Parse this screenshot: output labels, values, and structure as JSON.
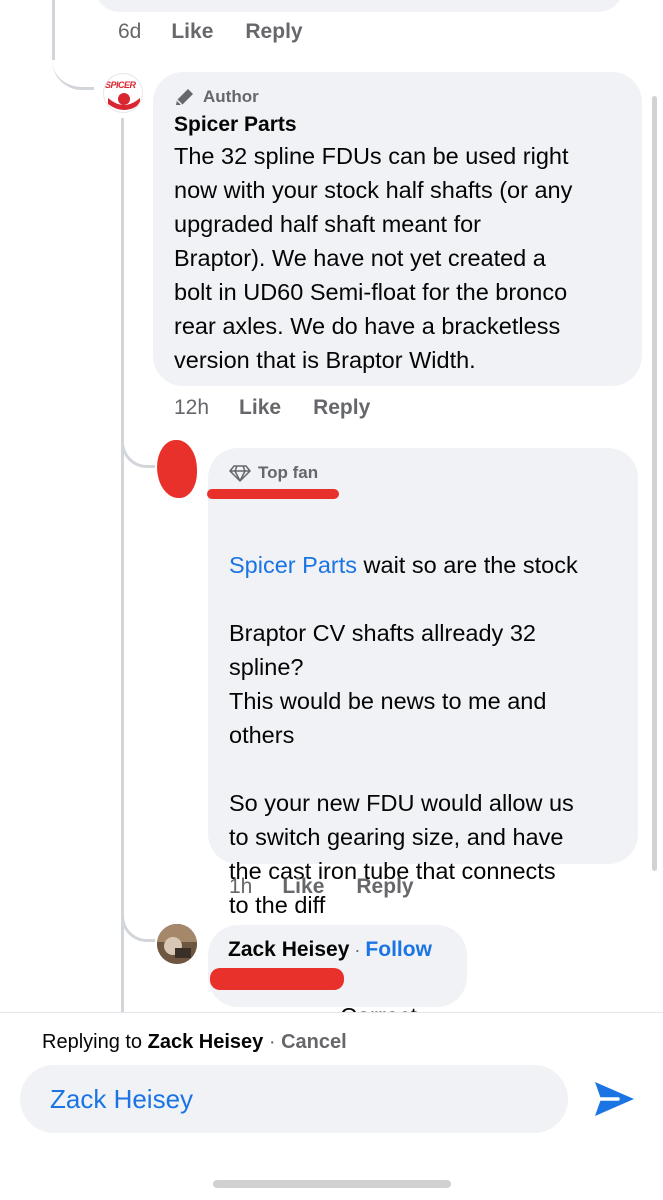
{
  "previous_comment": {
    "time": "6d",
    "like_label": "Like",
    "reply_label": "Reply"
  },
  "author_comment": {
    "avatar_text": "SPICER",
    "badge": "Author",
    "badge_icon": "pencil-icon",
    "name": "Spicer Parts",
    "text": "The 32 spline FDUs can be used right\nnow with your stock half shafts (or any\nupgraded half shaft meant for\nBraptor).  We have not yet created a\nbolt in UD60 Semi-float for the bronco\nrear axles.  We do have a bracketless\nversion that is Braptor Width.",
    "time": "12h",
    "like_label": "Like",
    "reply_label": "Reply"
  },
  "fan_comment": {
    "badge": "Top fan",
    "badge_icon": "diamond-icon",
    "mention": "Spicer Parts",
    "text_first_line": " wait so are the stock",
    "text_rest": "Braptor CV shafts allready 32\nspline?\nThis would be news to me and\nothers\n\nSo your new FDU would allow us\nto switch gearing size, and have\nthe cast iron tube that connects\nto the diff",
    "time": "1h",
    "like_label": "Like",
    "reply_label": "Reply"
  },
  "zack_comment": {
    "name": "Zack Heisey",
    "separator": "·",
    "follow_label": "Follow",
    "text": "Correct"
  },
  "composer": {
    "replying_prefix": "Replying to",
    "replying_name": "Zack Heisey",
    "separator": "·",
    "cancel_label": "Cancel",
    "input_value": "Zack Heisey",
    "send_icon": "send-icon"
  },
  "colors": {
    "bubble": "#f0f2f5",
    "link": "#1b74e4",
    "secondary_text": "#65676b",
    "redaction": "#e8312a"
  }
}
